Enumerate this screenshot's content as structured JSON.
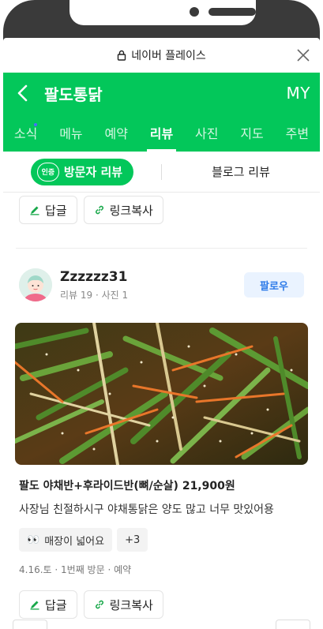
{
  "browser": {
    "title": "네이버 플레이스"
  },
  "header": {
    "place_name": "팔도통닭",
    "my_label": "MY"
  },
  "tabs": [
    {
      "label": "소식",
      "active": false,
      "has_dot": true
    },
    {
      "label": "메뉴",
      "active": false
    },
    {
      "label": "예약",
      "active": false
    },
    {
      "label": "리뷰",
      "active": true
    },
    {
      "label": "사진",
      "active": false
    },
    {
      "label": "지도",
      "active": false
    },
    {
      "label": "주변",
      "active": false
    }
  ],
  "review_type": {
    "badge": "인증",
    "visitor": "방문자 리뷰",
    "blog": "블로그 리뷰"
  },
  "actions": {
    "reply": "답글",
    "copy_link": "링크복사"
  },
  "review": {
    "author": "Zzzzzz31",
    "meta": "리뷰 19 · 사진 1",
    "follow": "팔로우",
    "menu": "팔도 야채반+후라이드반(뼈/순살) 21,900원",
    "text": "사장님 친절하시구 야채통닭은 양도 많고 너무 맛있어용",
    "tags": [
      {
        "emoji": "👀",
        "label": "매장이 넓어요"
      }
    ],
    "more_tags": "+3",
    "visit": "4.16.토 · 1번째 방문 · 예약"
  },
  "colors": {
    "brand_green": "#03c75a",
    "follow_blue": "#2c7ae8"
  }
}
